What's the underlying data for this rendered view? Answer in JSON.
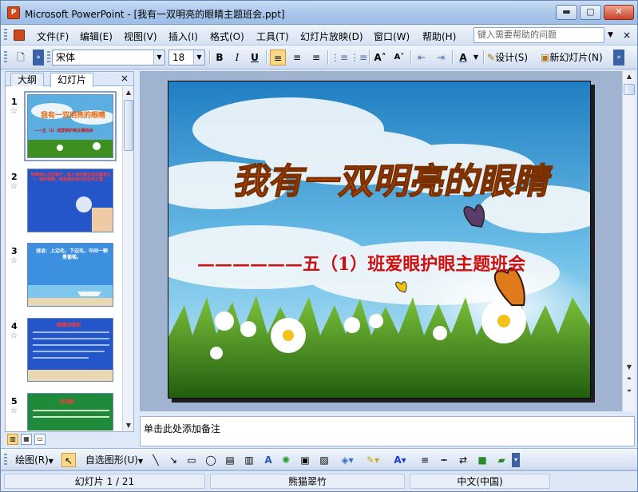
{
  "window": {
    "title": "Microsoft PowerPoint - [我有一双明亮的眼睛主题班会.ppt]",
    "app_icon": "powerpoint-icon",
    "min_label": "▬",
    "max_label": "▢",
    "close_label": "✕"
  },
  "menu": {
    "items": [
      "文件(F)",
      "编辑(E)",
      "视图(V)",
      "插入(I)",
      "格式(O)",
      "工具(T)",
      "幻灯片放映(D)",
      "窗口(W)",
      "帮助(H)"
    ],
    "help_placeholder": "键入需要帮助的问题",
    "close_x": "×"
  },
  "toolbar": {
    "font_name": "宋体",
    "font_size": "18",
    "bold": "B",
    "italic": "I",
    "underline": "U",
    "design_label": "设计(S)",
    "new_slide_label": "新幻灯片(N)",
    "font_color_label": "A"
  },
  "left_pane": {
    "tab_outline": "大纲",
    "tab_slides": "幻灯片",
    "close": "×",
    "slides": [
      {
        "number": "1",
        "title": "我有一双明亮的眼睛",
        "subtitle": "——五（1）班爱眼护眼主题班会"
      },
      {
        "number": "2",
        "text": "眼睛是心灵的窗户，是人体中最宝贵的器官之一。保护眼睛，就是保护我们的生命之窗。"
      },
      {
        "number": "3",
        "text": "谜语：上边毛，下边毛，中间一颗黑葡萄。"
      },
      {
        "number": "4",
        "text": "眼睛的结构"
      },
      {
        "number": "5",
        "text": "近视眼"
      }
    ]
  },
  "slide": {
    "title": "我有一双明亮的眼睛",
    "subtitle": "——————五（1）班爱眼护眼主题班会"
  },
  "notes": {
    "placeholder": "单击此处添加备注"
  },
  "draw_toolbar": {
    "draw_label": "绘图(R)",
    "autoshape_label": "自选图形(U)"
  },
  "status": {
    "slide_info": "幻灯片 1 / 21",
    "design": "熊猫翠竹",
    "language": "中文(中国)"
  },
  "colors": {
    "title_orange": "#e8680c",
    "subtitle_red": "#cc1010",
    "sky_blue": "#4e9fd6",
    "grass_green": "#3f8f20"
  }
}
